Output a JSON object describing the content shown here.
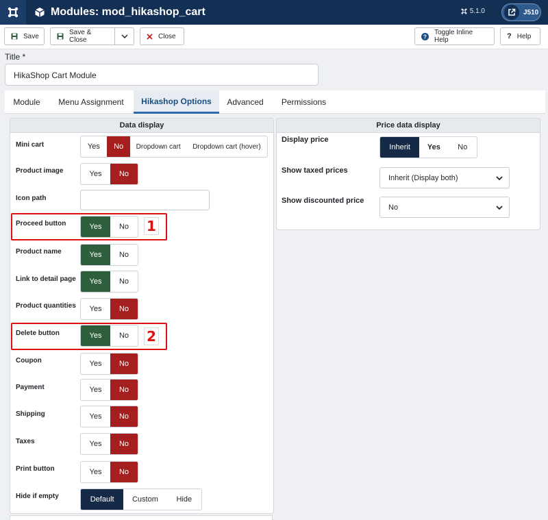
{
  "header": {
    "title": "Modules: mod_hikashop_cart",
    "version": "5.1.0",
    "user": "J510",
    "cube_icon": "cube-icon",
    "logo_icon": "joomla-logo-icon"
  },
  "toolbar": {
    "save": "Save",
    "save_close": "Save & Close",
    "close": "Close",
    "toggle_help": "Toggle Inline Help",
    "help": "Help"
  },
  "title_field": {
    "label": "Title *",
    "value": "HikaShop Cart Module"
  },
  "tabs": [
    "Module",
    "Menu Assignment",
    "Hikashop Options",
    "Advanced",
    "Permissions"
  ],
  "active_tab": "Hikashop Options",
  "data_display": {
    "heading": "Data display",
    "mini_cart": {
      "label": "Mini cart",
      "options": [
        "Yes",
        "No",
        "Dropdown cart",
        "Dropdown cart (hover)"
      ],
      "selected": "No"
    },
    "product_image": {
      "label": "Product image",
      "options": [
        "Yes",
        "No"
      ],
      "selected": "No"
    },
    "icon_path": {
      "label": "Icon path",
      "value": ""
    },
    "proceed_button": {
      "label": "Proceed button",
      "options": [
        "Yes",
        "No"
      ],
      "selected": "Yes"
    },
    "product_name": {
      "label": "Product name",
      "options": [
        "Yes",
        "No"
      ],
      "selected": "Yes"
    },
    "link_detail": {
      "label": "Link to detail page",
      "options": [
        "Yes",
        "No"
      ],
      "selected": "Yes"
    },
    "product_quantities": {
      "label": "Product quantities",
      "options": [
        "Yes",
        "No"
      ],
      "selected": "No"
    },
    "delete_button": {
      "label": "Delete button",
      "options": [
        "Yes",
        "No"
      ],
      "selected": "Yes"
    },
    "coupon": {
      "label": "Coupon",
      "options": [
        "Yes",
        "No"
      ],
      "selected": "No"
    },
    "payment": {
      "label": "Payment",
      "options": [
        "Yes",
        "No"
      ],
      "selected": "No"
    },
    "shipping": {
      "label": "Shipping",
      "options": [
        "Yes",
        "No"
      ],
      "selected": "No"
    },
    "taxes": {
      "label": "Taxes",
      "options": [
        "Yes",
        "No"
      ],
      "selected": "No"
    },
    "print_button": {
      "label": "Print button",
      "options": [
        "Yes",
        "No"
      ],
      "selected": "No"
    },
    "hide_if_empty": {
      "label": "Hide if empty",
      "options": [
        "Default",
        "Custom",
        "Hide"
      ],
      "selected": "Default"
    }
  },
  "price_display": {
    "heading": "Price data display",
    "display_price": {
      "label": "Display price",
      "options": [
        "Inherit",
        "Yes",
        "No"
      ],
      "selected": "Inherit"
    },
    "show_taxed": {
      "label": "Show taxed prices",
      "value": "Inherit (Display both)"
    },
    "show_discounted": {
      "label": "Show discounted price",
      "value": "No"
    }
  },
  "annotations": [
    "1",
    "2"
  ],
  "colors": {
    "header": "#132f53",
    "yes_on": "#2f5e3d",
    "no_on": "#a51f1f",
    "navy_on": "#152a46",
    "highlight": "#e01010"
  }
}
